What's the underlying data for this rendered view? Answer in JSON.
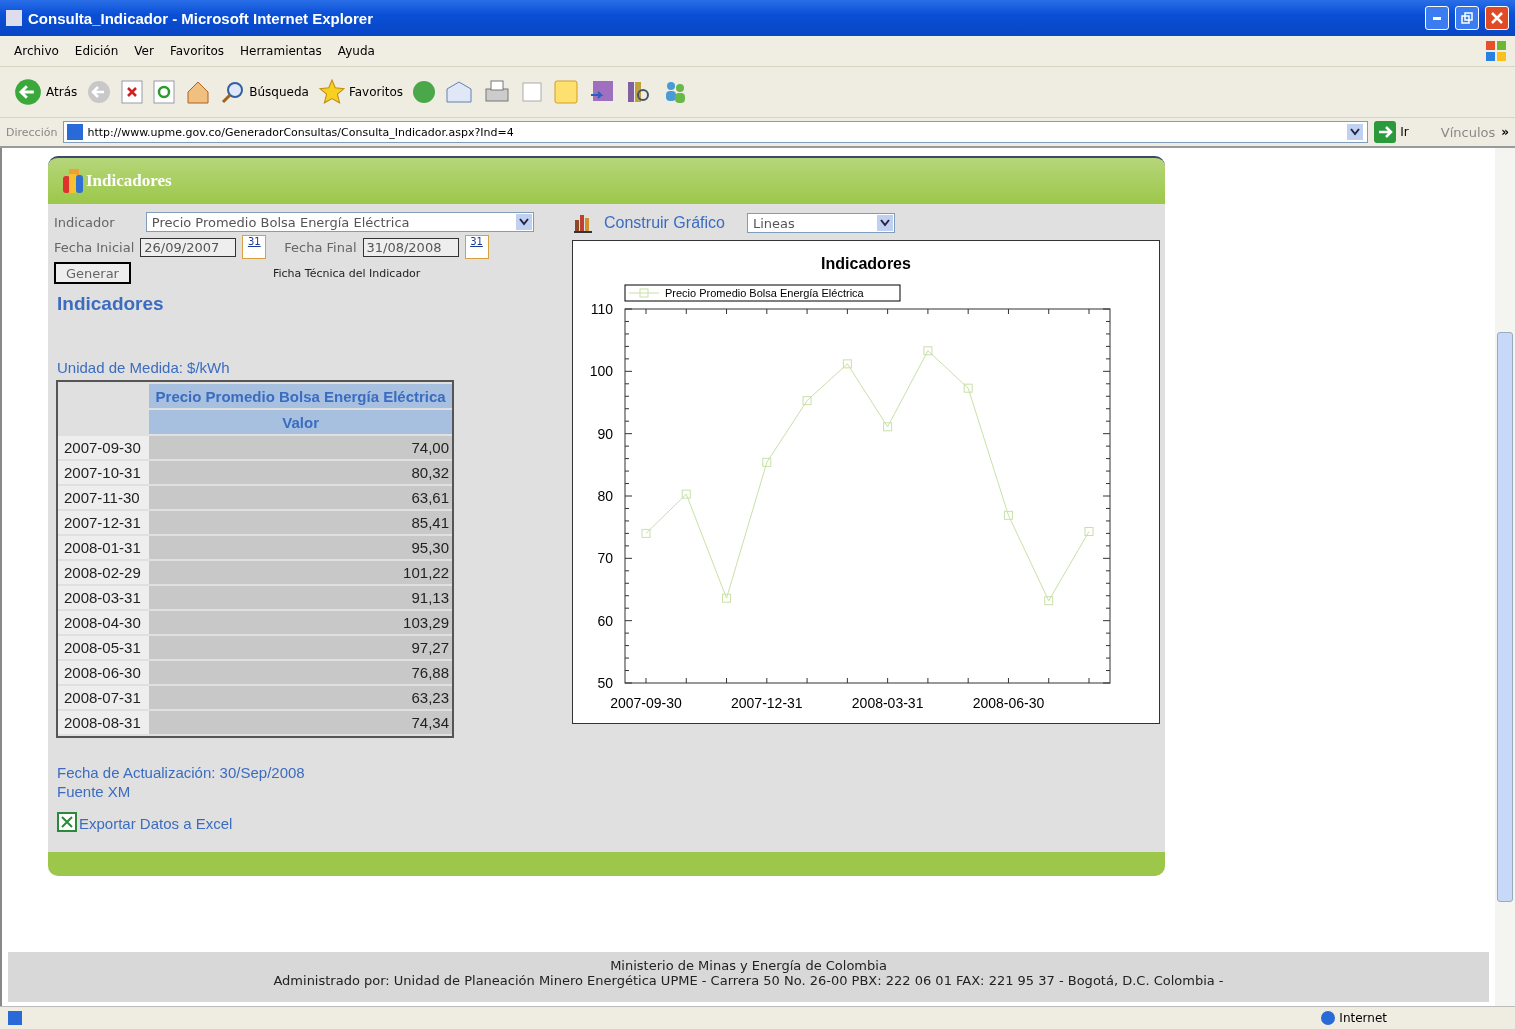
{
  "window": {
    "title": "Consulta_Indicador - Microsoft Internet Explorer"
  },
  "menu": [
    "Archivo",
    "Edición",
    "Ver",
    "Favoritos",
    "Herramientas",
    "Ayuda"
  ],
  "toolbar": {
    "back": "Atrás",
    "search": "Búsqueda",
    "favorites": "Favoritos"
  },
  "address": {
    "label": "Dirección",
    "url": "http://www.upme.gov.co/GeneradorConsultas/Consulta_Indicador.aspx?Ind=4",
    "go": "Ir",
    "links": "Vínculos",
    "more": "»"
  },
  "panel": {
    "title": "Indicadores",
    "form": {
      "indicator_label": "Indicador",
      "indicator": "Precio Promedio Bolsa Energía Eléctrica",
      "start_label": "Fecha Inicial",
      "start": "26/09/2007",
      "start_calendar_day": "31",
      "end_label": "Fecha Final",
      "end": "31/08/2008",
      "end_calendar_day": "31",
      "generate": "Generar",
      "tech_sheet": "Ficha Técnica del Indicador"
    },
    "heading": "Indicadores",
    "unit": "Unidad de Medida: $/kWh",
    "table": {
      "columns": [
        "",
        "Precio Promedio Bolsa Energía Eléctrica"
      ],
      "subcolumns": [
        "",
        "Valor"
      ],
      "rows": [
        [
          "2007-09-30",
          "74,00"
        ],
        [
          "2007-10-31",
          "80,32"
        ],
        [
          "2007-11-30",
          "63,61"
        ],
        [
          "2007-12-31",
          "85,41"
        ],
        [
          "2008-01-31",
          "95,30"
        ],
        [
          "2008-02-29",
          "101,22"
        ],
        [
          "2008-03-31",
          "91,13"
        ],
        [
          "2008-04-30",
          "103,29"
        ],
        [
          "2008-05-31",
          "97,27"
        ],
        [
          "2008-06-30",
          "76,88"
        ],
        [
          "2008-07-31",
          "63,23"
        ],
        [
          "2008-08-31",
          "74,34"
        ]
      ]
    },
    "updated": "Fecha de Actualización: 30/Sep/2008",
    "source": "Fuente XM",
    "export": "Exportar Datos a Excel",
    "chart_controls": {
      "build": "Construir Gráfico",
      "type": "Lineas"
    },
    "chart_data": {
      "type": "line",
      "title": "Indicadores",
      "categories": [
        "2007-09-30",
        null,
        null,
        "2007-12-31",
        null,
        null,
        "2008-03-31",
        null,
        null,
        "2008-06-30",
        null,
        null
      ],
      "series": [
        {
          "name": "Precio Promedio Bolsa Energía Eléctrica",
          "color": "#c8e0a8",
          "marker": "square",
          "values": [
            74.0,
            80.3,
            63.6,
            85.4,
            95.3,
            101.2,
            91.1,
            103.3,
            97.3,
            76.9,
            63.2,
            74.3
          ]
        }
      ],
      "ylim": [
        50,
        110
      ],
      "yticks": [
        50,
        60,
        70,
        80,
        90,
        100,
        110
      ]
    }
  },
  "footer": [
    "Ministerio de Minas y Energía de Colombia",
    "Administrado por: Unidad de Planeación Minero Energética UPME - Carrera 50 No. 26-00 PBX: 222 06 01 FAX: 221 95 37 - Bogotá, D.C. Colombia -"
  ],
  "status_bar": {
    "zone": "Internet"
  }
}
